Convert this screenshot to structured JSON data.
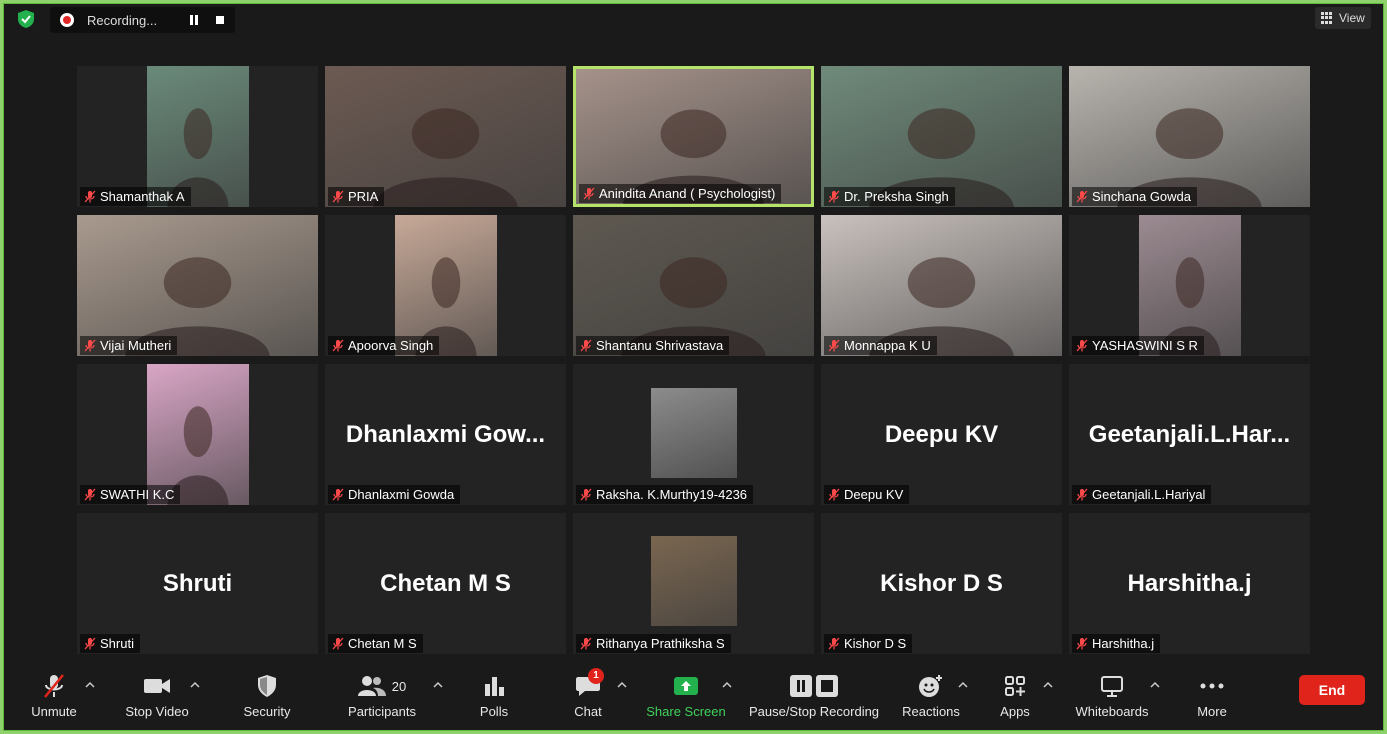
{
  "recording": {
    "status_text": "Recording..."
  },
  "view_button": {
    "label": "View"
  },
  "tiles": [
    {
      "label": "Shamanthak A",
      "big": "",
      "bg": "#6a8a7a",
      "video": true
    },
    {
      "label": "PRIA",
      "big": "",
      "bg": "#6c5a52",
      "video": true
    },
    {
      "label": "Anindita Anand ( Psychologist)",
      "big": "",
      "bg": "#a5928a",
      "video": true,
      "active": true
    },
    {
      "label": "Dr. Preksha Singh",
      "big": "",
      "bg": "#6f8a7a",
      "video": true
    },
    {
      "label": "Sinchana Gowda",
      "big": "",
      "bg": "#b8b4ae",
      "video": true
    },
    {
      "label": "Vijai Mutheri",
      "big": "",
      "bg": "#a99a8e",
      "video": true
    },
    {
      "label": "Apoorva Singh",
      "big": "",
      "bg": "#c7a998",
      "video": true
    },
    {
      "label": "Shantanu Shrivastava",
      "big": "",
      "bg": "#5e5850",
      "video": true
    },
    {
      "label": "Monnappa K U",
      "big": "",
      "bg": "#c9c1bd",
      "video": true
    },
    {
      "label": "YASHASWINI S R",
      "big": "",
      "bg": "#9c8b92",
      "video": true
    },
    {
      "label": "SWATHI K.C",
      "big": "",
      "bg": "#d9a6c6",
      "video": true
    },
    {
      "label": "Dhanlaxmi Gowda",
      "big": "Dhanlaxmi  Gow...",
      "bg": "",
      "video": false
    },
    {
      "label": "Raksha. K.Murthy19-4236",
      "big": "",
      "bg": "#8c8c8c",
      "video": true,
      "photo": true
    },
    {
      "label": "Deepu KV",
      "big": "Deepu KV",
      "bg": "",
      "video": false
    },
    {
      "label": "Geetanjali.L.Hariyal",
      "big": "Geetanjali.L.Har...",
      "bg": "",
      "video": false
    },
    {
      "label": "Shruti",
      "big": "Shruti",
      "bg": "",
      "video": false
    },
    {
      "label": "Chetan M S",
      "big": "Chetan M S",
      "bg": "",
      "video": false
    },
    {
      "label": "Rithanya Prathiksha S",
      "big": "",
      "bg": "#7a6650",
      "video": true,
      "photo": true
    },
    {
      "label": "Kishor D S",
      "big": "Kishor D S",
      "bg": "",
      "video": false
    },
    {
      "label": "Harshitha.j",
      "big": "Harshitha.j",
      "bg": "",
      "video": false
    }
  ],
  "toolbar": {
    "unmute": "Unmute",
    "stop_video": "Stop Video",
    "security": "Security",
    "participants": "Participants",
    "participants_count": "20",
    "polls": "Polls",
    "chat": "Chat",
    "chat_badge": "1",
    "share_screen": "Share Screen",
    "pause_stop_recording": "Pause/Stop Recording",
    "reactions": "Reactions",
    "apps": "Apps",
    "whiteboards": "Whiteboards",
    "more": "More",
    "end": "End"
  },
  "colors": {
    "accent_green": "#3fd15a",
    "end_red": "#e0241b",
    "active_border": "#b5e36a"
  }
}
